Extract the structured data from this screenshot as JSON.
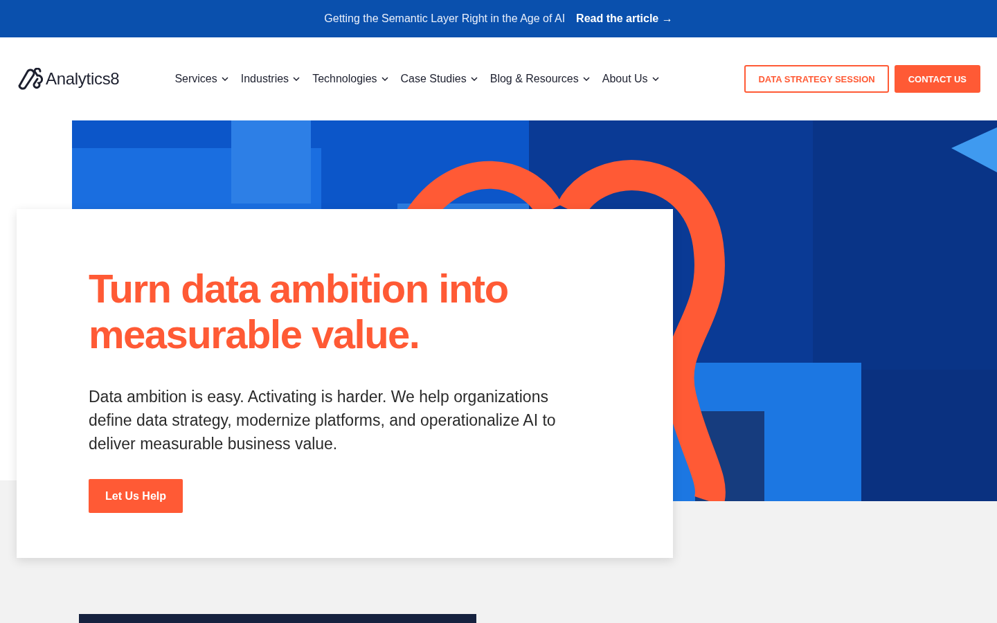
{
  "announcement": {
    "text": "Getting the Semantic Layer Right in the Age of AI",
    "link": "Read the article →"
  },
  "header": {
    "logo": "Analytics8",
    "nav": [
      {
        "label": "Services"
      },
      {
        "label": "Industries"
      },
      {
        "label": "Technologies"
      },
      {
        "label": "Case Studies"
      },
      {
        "label": "Blog & Resources"
      },
      {
        "label": "About Us"
      }
    ],
    "buttons": [
      {
        "label": "DATA STRATEGY SESSION",
        "kind": "outline"
      },
      {
        "label": "CONTACT US",
        "kind": "solid"
      }
    ]
  },
  "hero": {
    "title": "Turn data ambition into measurable value.",
    "body": "Data ambition is easy. Activating is harder. We help organizations define data strategy, modernize platforms, and operationalize AI to deliver measurable business value.",
    "cta": "Let Us Help"
  }
}
